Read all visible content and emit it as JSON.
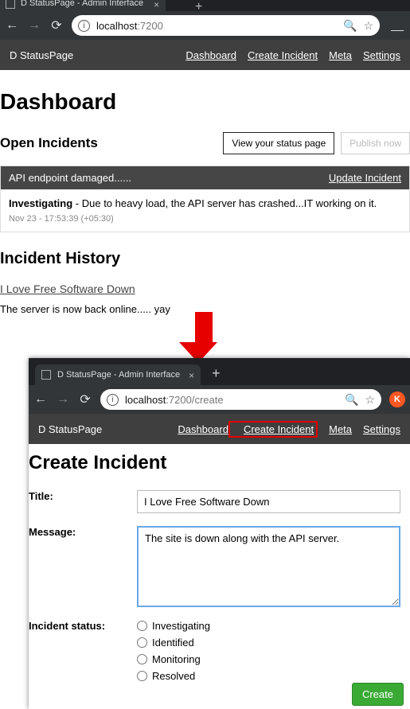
{
  "browser1": {
    "tab_title": "D StatusPage - Admin Interface",
    "url_host": "localhost",
    "url_port": ":7200"
  },
  "appbar": {
    "brand": "D StatusPage",
    "links": [
      "Dashboard",
      "Create Incident",
      "Meta",
      "Settings"
    ]
  },
  "dashboard": {
    "heading": "Dashboard",
    "open_heading": "Open Incidents",
    "view_btn": "View your status page",
    "publish_btn": "Publish now",
    "incident": {
      "title": "API endpoint damaged......",
      "update": "Update Incident",
      "status": "Investigating",
      "msg": " - Due to heavy load, the API server has crashed...IT working on it.",
      "meta": "Nov 23 - 17:53:39 (+05:30)"
    },
    "history_heading": "Incident History",
    "history_link": "I Love Free Software Down",
    "history_msg": "The server is now back online..... yay"
  },
  "browser2": {
    "tab_title": "D StatusPage - Admin Interface",
    "url_host": "localhost",
    "url_rest": ":7200/create",
    "avatar": "K"
  },
  "appbar2": {
    "brand": "D StatusPage",
    "links": [
      "Dashboard",
      "Create Incident",
      "Meta",
      "Settings"
    ]
  },
  "create": {
    "heading": "Create Incident",
    "title_label": "Title:",
    "title_value": "I Love Free Software Down",
    "message_label": "Message:",
    "message_value": "The site is down along with the API server.",
    "status_label": "Incident status:",
    "statuses": [
      "Investigating",
      "Identified",
      "Monitoring",
      "Resolved"
    ],
    "create_btn": "Create"
  }
}
